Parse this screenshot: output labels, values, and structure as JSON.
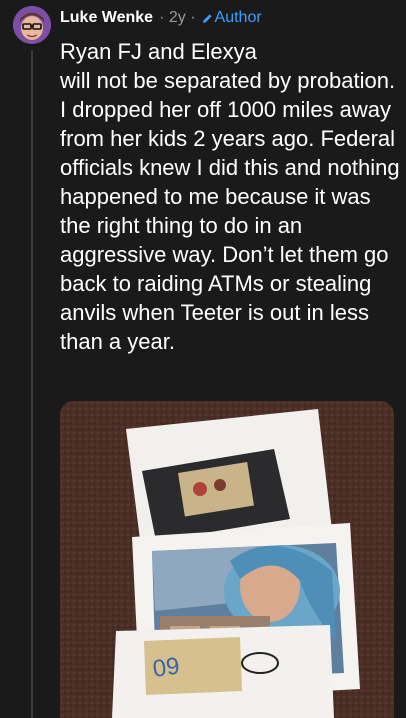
{
  "comment": {
    "username": "Luke Wenke",
    "age": "· 2y ·",
    "author_badge": "Author",
    "author_icon": "pencil-icon",
    "body": "Ryan FJ             and Elexya\n          will not be separated by probation.  I dropped her off 1000 miles away from her kids 2 years ago.  Federal officials knew I did this and nothing happened to me because it was the right thing to do in an aggressive way.  Don’t let them go back to raiding ATMs or stealing anvils when Teeter is out in less than a year."
  },
  "colors": {
    "background": "#1a1a1b",
    "username": "#ffffff",
    "meta": "#9a9a9e",
    "author": "#3aa0ff",
    "body_text": "#ffffff"
  }
}
